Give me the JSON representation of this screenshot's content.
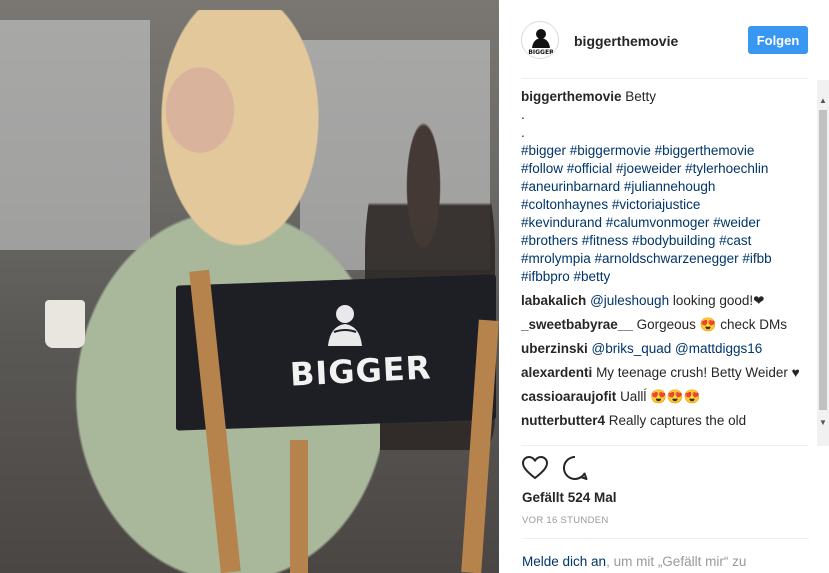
{
  "post": {
    "username": "biggerthemovie",
    "follow_label": "Folgen",
    "avatar_icon": "bigger-logo-icon",
    "brand_text": "BIGGER",
    "avatar_text": "BIGGER"
  },
  "caption": {
    "user": "biggerthemovie",
    "text": "Betty",
    "dot1": ".",
    "dot2": ".",
    "hashtags": [
      "#bigger #biggermovie #biggerthemovie",
      "#follow #official #joeweider #tylerhoechlin",
      "#aneurinbarnard #juliannehough",
      "#coltonhaynes #victoriajustice",
      "#kevindurand #calumvonmoger #weider",
      "#brothers #fitness #bodybuilding #cast",
      "#mrolympia #arnoldschwarzenegger #ifbb",
      "#ifbbpro #betty"
    ]
  },
  "comments": [
    {
      "user": "labakalich",
      "mention": "@juleshough",
      "text": " looking good!❤"
    },
    {
      "user": "_sweetbabyrae__",
      "mention": "",
      "text": "Gorgeous 😍 check DMs"
    },
    {
      "user": "uberzinski",
      "mention": "@briks_quad @mattdiggs16",
      "text": ""
    },
    {
      "user": "alexardenti",
      "mention": "",
      "text": "My teenage crush! Betty Weider ♥"
    },
    {
      "user": "cassioaraujofit",
      "mention": "",
      "text": "Uallĺ 😍😍😍"
    },
    {
      "user": "nutterbutter4",
      "mention": "",
      "text": "Really captures the old"
    }
  ],
  "actions": {
    "like_icon": "heart-icon",
    "comment_icon": "comment-bubble-icon",
    "likes_text": "Gefällt 524 Mal",
    "timestamp": "VOR 16 STUNDEN",
    "login_link": "Melde dich an",
    "login_rest": ", um mit „Gefällt mir“ zu"
  },
  "colors": {
    "follow_button": "#3897f0",
    "link": "#003569",
    "muted": "#999999"
  }
}
